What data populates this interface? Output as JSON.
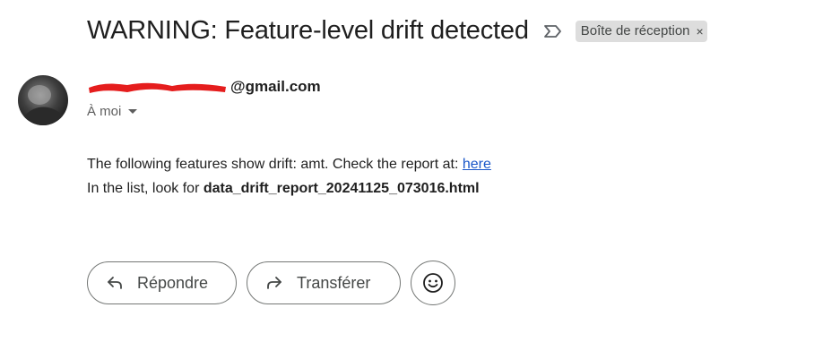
{
  "email": {
    "subject": "WARNING: Feature-level drift detected",
    "label": "Boîte de réception",
    "sender_visible": "@gmail.com",
    "recipient": "À moi",
    "body": {
      "line1_text": "The following features show drift: amt. Check the report at: ",
      "line1_link": "here",
      "line2_text": "In the list, look for ",
      "line2_bold": "data_drift_report_20241125_073016.html"
    }
  },
  "actions": {
    "reply_label": "Répondre",
    "forward_label": "Transférer"
  },
  "colors": {
    "link": "#1a57c9",
    "redaction": "#e51d1d",
    "chip_bg": "#dddddd"
  }
}
